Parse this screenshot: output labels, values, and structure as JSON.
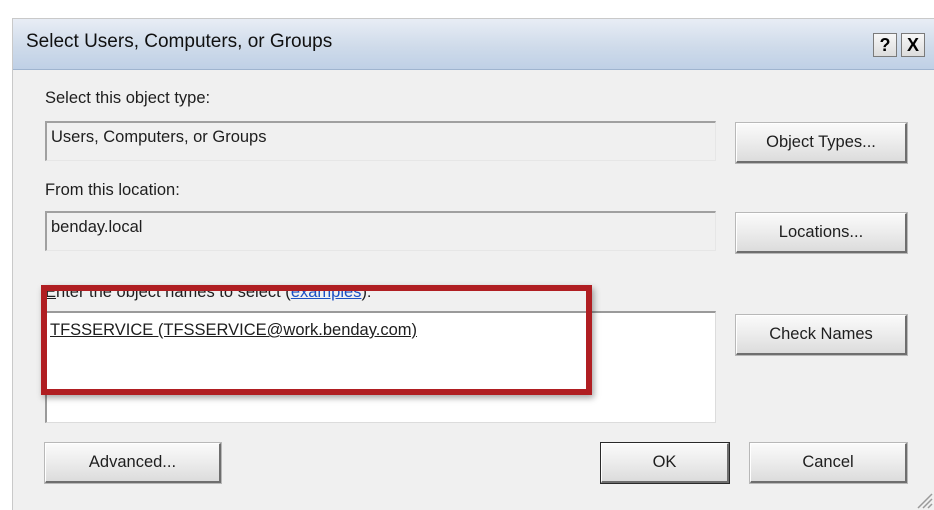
{
  "window": {
    "title": "Select Users, Computers, or Groups",
    "help_button": "?",
    "close_button": "X"
  },
  "object_type": {
    "label": "Select this object type:",
    "value": "Users, Computers, or Groups",
    "button": "Object Types..."
  },
  "location": {
    "label": "From this location:",
    "value": "benday.local",
    "button": "Locations..."
  },
  "object_names": {
    "label_first_letter": "E",
    "label_rest": "nter the object names to select (",
    "examples_link": "examples",
    "label_end": "):",
    "value": "TFSSERVICE (TFSSERVICE@work.benday.com)",
    "check_button": "Check Names"
  },
  "footer": {
    "advanced_button": "Advanced...",
    "ok_button": "OK",
    "cancel_button": "Cancel"
  },
  "colors": {
    "highlight": "#b01e22",
    "link": "#1a4fc4"
  }
}
